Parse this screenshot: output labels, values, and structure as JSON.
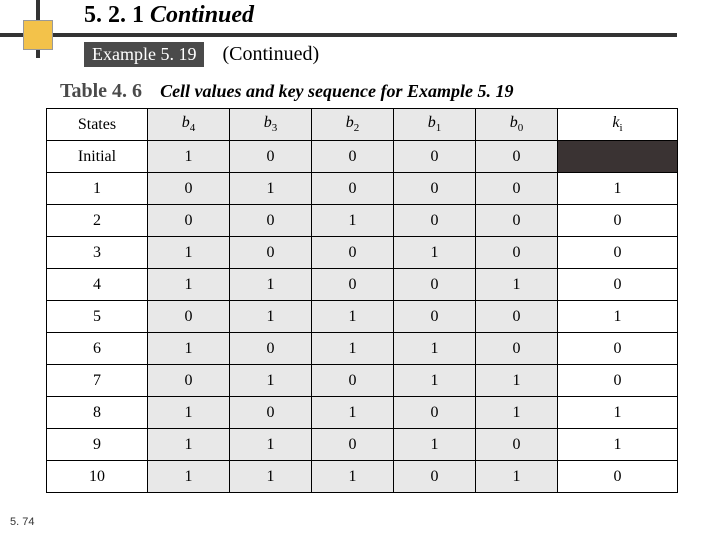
{
  "section_number": "5. 2. 1",
  "section_word": "Continued",
  "example_label": "Example 5. 19",
  "continued": "(Continued)",
  "table_number": "Table 4. 6",
  "table_caption": "Cell values and key sequence for Example 5. 19",
  "page_number": "5. 74",
  "headers": {
    "states": "States",
    "b4_base": "b",
    "b4_sub": "4",
    "b3_base": "b",
    "b3_sub": "3",
    "b2_base": "b",
    "b2_sub": "2",
    "b1_base": "b",
    "b1_sub": "1",
    "b0_base": "b",
    "b0_sub": "0",
    "ki_base": "k",
    "ki_sub": "i"
  },
  "rows": [
    {
      "state": "Initial",
      "b4": "1",
      "b3": "0",
      "b2": "0",
      "b1": "0",
      "b0": "0",
      "ki": "",
      "black": true
    },
    {
      "state": "1",
      "b4": "0",
      "b3": "1",
      "b2": "0",
      "b1": "0",
      "b0": "0",
      "ki": "1",
      "black": false
    },
    {
      "state": "2",
      "b4": "0",
      "b3": "0",
      "b2": "1",
      "b1": "0",
      "b0": "0",
      "ki": "0",
      "black": false
    },
    {
      "state": "3",
      "b4": "1",
      "b3": "0",
      "b2": "0",
      "b1": "1",
      "b0": "0",
      "ki": "0",
      "black": false
    },
    {
      "state": "4",
      "b4": "1",
      "b3": "1",
      "b2": "0",
      "b1": "0",
      "b0": "1",
      "ki": "0",
      "black": false
    },
    {
      "state": "5",
      "b4": "0",
      "b3": "1",
      "b2": "1",
      "b1": "0",
      "b0": "0",
      "ki": "1",
      "black": false
    },
    {
      "state": "6",
      "b4": "1",
      "b3": "0",
      "b2": "1",
      "b1": "1",
      "b0": "0",
      "ki": "0",
      "black": false
    },
    {
      "state": "7",
      "b4": "0",
      "b3": "1",
      "b2": "0",
      "b1": "1",
      "b0": "1",
      "ki": "0",
      "black": false
    },
    {
      "state": "8",
      "b4": "1",
      "b3": "0",
      "b2": "1",
      "b1": "0",
      "b0": "1",
      "ki": "1",
      "black": false
    },
    {
      "state": "9",
      "b4": "1",
      "b3": "1",
      "b2": "0",
      "b1": "1",
      "b0": "0",
      "ki": "1",
      "black": false
    },
    {
      "state": "10",
      "b4": "1",
      "b3": "1",
      "b2": "1",
      "b1": "0",
      "b0": "1",
      "ki": "0",
      "black": false
    }
  ]
}
